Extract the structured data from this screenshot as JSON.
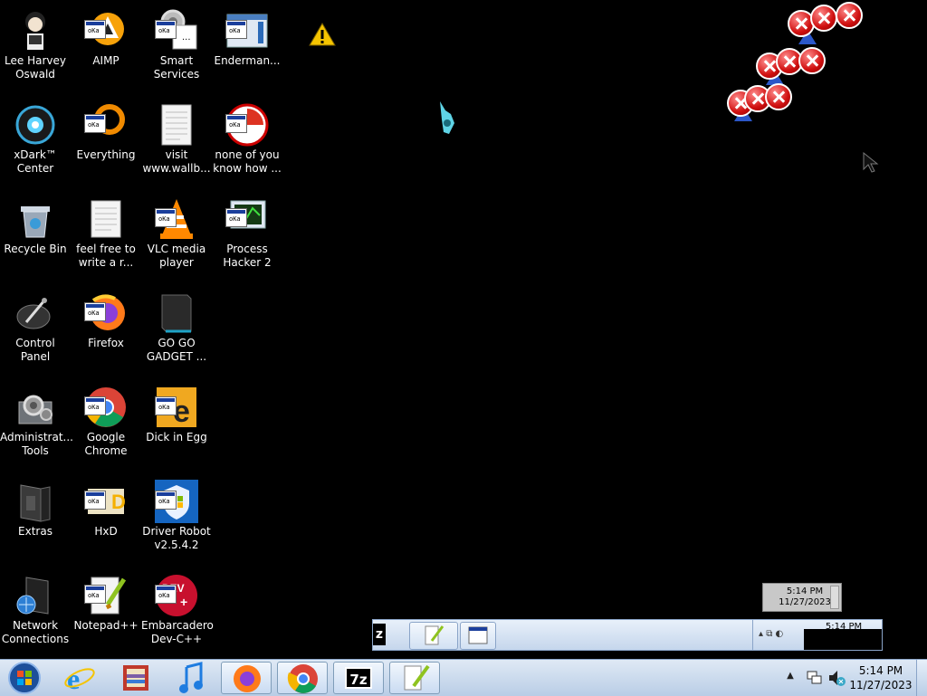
{
  "desktop": {
    "icons": [
      {
        "label": "Lee Harvey Oswald",
        "icon": "character-icon"
      },
      {
        "label": "AIMP",
        "icon": "aimp-icon"
      },
      {
        "label": "Smart Services",
        "icon": "gear-icon"
      },
      {
        "label": "Enderman...",
        "icon": "window-icon"
      },
      {
        "label": "xDark™ Center",
        "icon": "xdark-orb-icon"
      },
      {
        "label": "Everything",
        "icon": "everything-icon"
      },
      {
        "label": "visit www.wallb...",
        "icon": "document-icon"
      },
      {
        "label": "none of you know how ...",
        "icon": "document-icon"
      },
      {
        "label": "Recycle Bin",
        "icon": "recycle-bin-icon"
      },
      {
        "label": "feel free to write a r...",
        "icon": "document-icon"
      },
      {
        "label": "VLC media player",
        "icon": "vlc-cone-icon"
      },
      {
        "label": "Process Hacker 2",
        "icon": "process-hacker-icon"
      },
      {
        "label": "Control Panel",
        "icon": "control-panel-icon"
      },
      {
        "label": "Firefox",
        "icon": "firefox-icon"
      },
      {
        "label": "GO GO GADGET ...",
        "icon": "gadget-icon"
      },
      {
        "label": "Administrat... Tools",
        "icon": "admin-tools-icon"
      },
      {
        "label": "Google Chrome",
        "icon": "chrome-icon"
      },
      {
        "label": "Dick in Egg",
        "icon": "egg-icon"
      },
      {
        "label": "Extras",
        "icon": "folder-icon"
      },
      {
        "label": "HxD",
        "icon": "hxd-icon"
      },
      {
        "label": "Driver Robot v2.5.4.2",
        "icon": "driver-robot-icon"
      },
      {
        "label": "Network Connections",
        "icon": "network-icon"
      },
      {
        "label": "Notepad++",
        "icon": "notepad-plus-icon"
      },
      {
        "label": "Embarcadero Dev-C++",
        "icon": "devcpp-icon"
      }
    ]
  },
  "ghost_tray": {
    "clock_time": "5:14 PM",
    "clock_date": "11/27/2023",
    "partial_time": "5:14 PM"
  },
  "ghost_taskbar": {
    "sevenzip_text": "z"
  },
  "taskbar": {
    "pinned": [
      {
        "name": "internet-explorer-icon"
      },
      {
        "name": "archive-manager-icon"
      },
      {
        "name": "itunes-icon"
      },
      {
        "name": "firefox-icon"
      },
      {
        "name": "chrome-icon"
      },
      {
        "name": "7zip-icon",
        "text": "7z"
      },
      {
        "name": "notepad-plus-icon"
      }
    ],
    "clock_time": "5:14 PM",
    "clock_date": "11/27/2023"
  },
  "colors": {
    "desktop_bg": "#000000",
    "taskbar_bg": "#c9dbf2",
    "error_red": "#d01010",
    "warning_yellow": "#f5c400"
  }
}
